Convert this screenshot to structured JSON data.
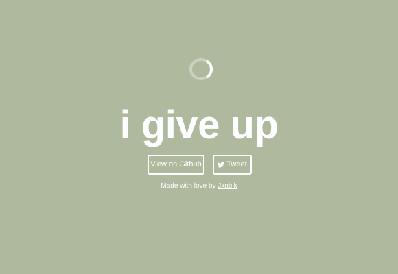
{
  "page": {
    "background_color": "#aeb99e",
    "foreground_color": "#ffffff"
  },
  "spinner": {
    "icon": "loading-spinner-icon"
  },
  "headline": {
    "text": "i give up"
  },
  "buttons": {
    "github_label": "View on Github",
    "tweet_label": "Tweet",
    "tweet_icon": "twitter-bird-icon"
  },
  "credit": {
    "prefix": "Made with love by ",
    "author_link": "Jxnblk"
  }
}
